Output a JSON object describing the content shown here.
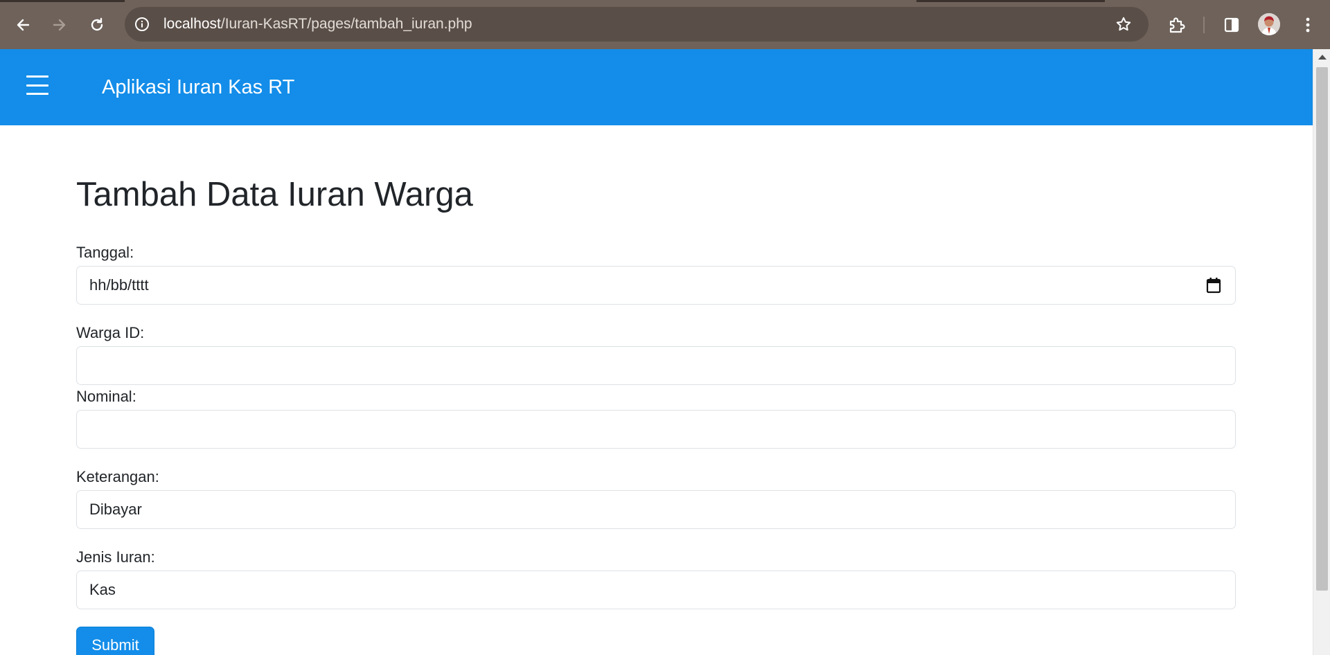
{
  "browser": {
    "url_host": "localhost",
    "url_path": "/Iuran-KasRT/pages/tambah_iuran.php",
    "icons": {
      "back": "back-arrow-icon",
      "forward": "forward-arrow-icon",
      "reload": "reload-icon",
      "site_info": "info-icon",
      "bookmark": "star-icon",
      "extensions": "puzzle-icon",
      "side_panel": "side-panel-icon",
      "profile": "avatar",
      "menu": "kebab-menu-icon"
    },
    "colors": {
      "frame": "#6e625a",
      "omnibox": "#5a4f48"
    }
  },
  "app": {
    "brand": "Aplikasi Iuran Kas RT",
    "menu_icon": "hamburger-icon",
    "colors": {
      "navbar": "#138de9",
      "button": "#138de9"
    }
  },
  "form": {
    "title": "Tambah Data Iuran Warga",
    "fields": {
      "tanggal": {
        "label": "Tanggal:",
        "value": "hh/bb/tttt"
      },
      "warga_id": {
        "label": "Warga ID:",
        "value": ""
      },
      "nominal": {
        "label": "Nominal:",
        "value": ""
      },
      "keterangan": {
        "label": "Keterangan:",
        "value": "Dibayar"
      },
      "jenis_iuran": {
        "label": "Jenis Iuran:",
        "value": "Kas"
      }
    },
    "submit_label": "Submit"
  }
}
